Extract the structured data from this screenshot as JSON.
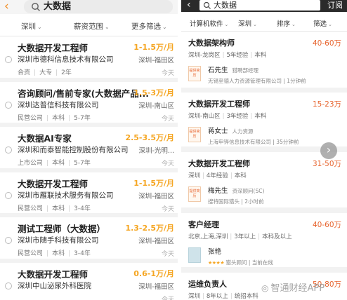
{
  "left": {
    "query": "大数据",
    "filters": [
      "深圳",
      "薪资范围",
      "更多筛选"
    ],
    "jobs": [
      {
        "title": "大数据开发工程师",
        "salary": "1-1.5万/月",
        "company": "深圳市德科信息技术有限公司",
        "location": "深圳-福田区",
        "type": "合资",
        "edu": "大专",
        "exp": "2年",
        "time": "今天"
      },
      {
        "title": "咨询顾问/售前专家(大数据产品...",
        "salary": "1.5-3万/月",
        "company": "深圳达普信科技有限公司",
        "location": "深圳-南山区",
        "type": "民营公司",
        "edu": "本科",
        "exp": "5-7年",
        "time": "今天"
      },
      {
        "title": "大数据AI专家",
        "salary": "2.5-3.5万/月",
        "company": "深圳和而泰智能控制股份有限公司",
        "location": "深圳-光明...",
        "type": "上市公司",
        "edu": "本科",
        "exp": "5-7年",
        "time": "今天"
      },
      {
        "title": "大数据开发工程师",
        "salary": "1-1.5万/月",
        "company": "深圳市雁联技术服务有限公司",
        "location": "深圳-福田区",
        "type": "民营公司",
        "edu": "本科",
        "exp": "3-4年",
        "time": "今天"
      },
      {
        "title": "测试工程师（大数据）",
        "salary": "1.3-2.5万/月",
        "company": "深圳市随手科技有限公司",
        "location": "深圳-福田区",
        "type": "民营公司",
        "edu": "本科",
        "exp": "3-4年",
        "time": "今天"
      },
      {
        "title": "大数据开发工程师",
        "salary": "0.6-1万/月",
        "company": "深圳中山泌尿外科医院",
        "location": "深圳-福田区",
        "type": "",
        "edu": "",
        "exp": "",
        "time": "今天"
      }
    ]
  },
  "right": {
    "query": "大数据",
    "subscribe": "订阅",
    "filters": [
      "计算机软件",
      "深圳",
      "排序",
      "筛选"
    ],
    "jobs": [
      {
        "title": "大数据架构师",
        "salary": "40-60万",
        "location": "深圳-龙岗区",
        "exp": "5年经验",
        "edu": "本科",
        "logo": "提供简历",
        "recruiter": "石先生",
        "role": "猎聘部经理",
        "firm": "无锡至德人力资源管理有限公司 | 1分钟前"
      },
      {
        "title": "大数据开发工程师",
        "salary": "15-23万",
        "location": "深圳-南山区",
        "exp": "3年经验",
        "edu": "本科",
        "logo": "提供简历",
        "recruiter": "蒋女士",
        "role": "人力资源",
        "firm": "上海申铧信息技术有限公司 | 35分钟前"
      },
      {
        "title": "大数据开发工程师",
        "salary": "31-50万",
        "location": "深圳",
        "exp": "4年经验",
        "edu": "本科",
        "logo": "提供简历",
        "recruiter": "梅先生",
        "role": "资深顾问(SC)",
        "firm": "搜特国际猎头 | 2小时前"
      },
      {
        "title": "客户经理",
        "salary": "40-60万",
        "location": "北京,上海,深圳",
        "exp": "3年以上",
        "edu": "本科及以上",
        "logo": "",
        "recruiter": "张艳",
        "role": "",
        "stars": "★★★★",
        "firm": "猎头顾问 | 当前在线"
      },
      {
        "title": "运维负责人",
        "salary": "50-80万",
        "location": "深圳",
        "exp": "8年以上",
        "edu": "统招本科",
        "logo": "",
        "recruiter": "",
        "role": "",
        "firm": ""
      }
    ],
    "watermark": "智通财经APP"
  }
}
